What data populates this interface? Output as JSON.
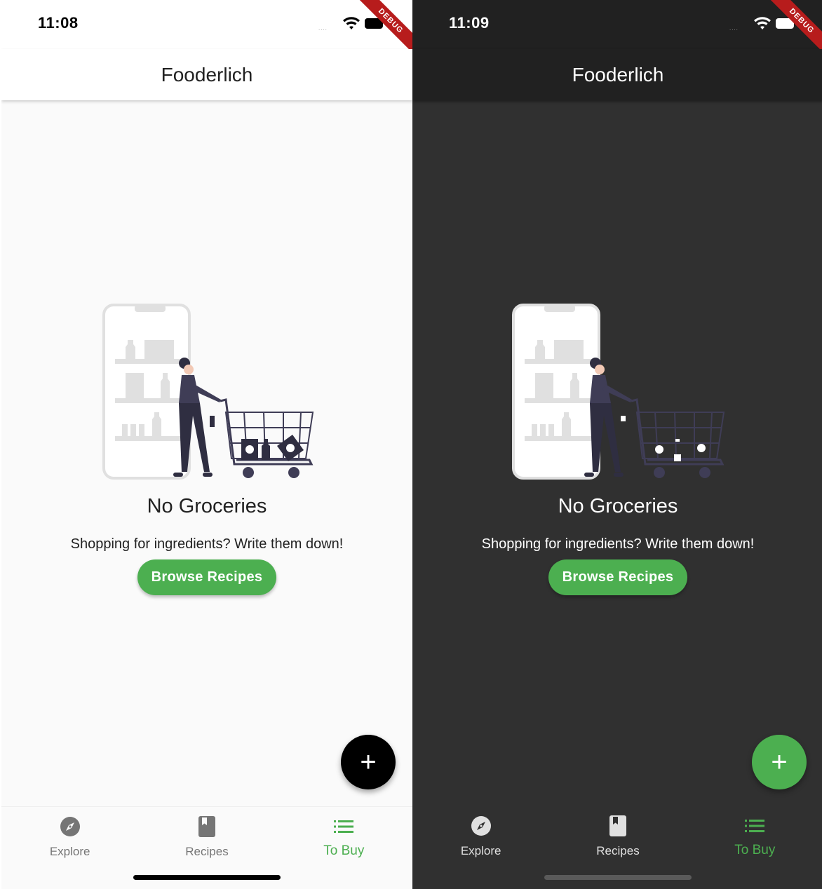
{
  "screens": [
    {
      "theme": "light",
      "status": {
        "time": "11:08",
        "signal": "....",
        "badge": "DEBUG"
      },
      "appbar": {
        "title": "Fooderlich"
      },
      "empty": {
        "title": "No Groceries",
        "subtitle": "Shopping for ingredients? Write them down!",
        "button_label": "Browse Recipes"
      },
      "fab": {
        "label": "+"
      },
      "nav": {
        "items": [
          {
            "label": "Explore",
            "icon": "compass-icon"
          },
          {
            "label": "Recipes",
            "icon": "book-icon"
          },
          {
            "label": "To Buy",
            "icon": "list-icon",
            "active": true
          }
        ]
      }
    },
    {
      "theme": "dark",
      "status": {
        "time": "11:09",
        "signal": "....",
        "badge": "DEBUG"
      },
      "appbar": {
        "title": "Fooderlich"
      },
      "empty": {
        "title": "No Groceries",
        "subtitle": "Shopping for ingredients? Write them down!",
        "button_label": "Browse Recipes"
      },
      "fab": {
        "label": "+"
      },
      "nav": {
        "items": [
          {
            "label": "Explore",
            "icon": "compass-icon"
          },
          {
            "label": "Recipes",
            "icon": "book-icon"
          },
          {
            "label": "To Buy",
            "icon": "list-icon",
            "active": true
          }
        ]
      }
    }
  ],
  "colors": {
    "accent": "#4caf50",
    "light_bg": "#fafafa",
    "dark_bg": "#303030",
    "dark_appbar": "#212121",
    "debug_ribbon": "#b71c1c"
  }
}
